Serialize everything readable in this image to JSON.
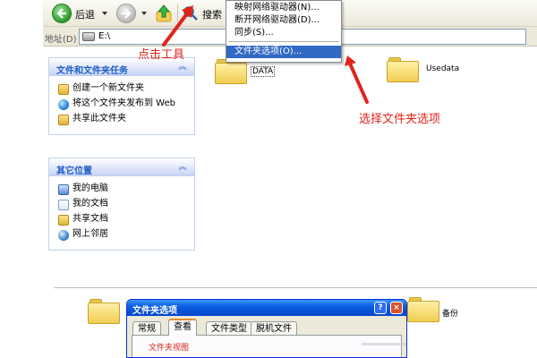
{
  "toolbar": {
    "back_label": "后退",
    "search_label": "搜索"
  },
  "address": {
    "label": "地址(D)",
    "path": "E:\\"
  },
  "file_tasks": {
    "title": "文件和文件夹任务",
    "items": [
      {
        "label": "创建一个新文件夹",
        "icon": "new-folder-icon"
      },
      {
        "label": "将这个文件夹发布到 Web",
        "icon": "globe-icon"
      },
      {
        "label": "共享此文件夹",
        "icon": "share-icon"
      }
    ]
  },
  "other_places": {
    "title": "其它位置",
    "items": [
      {
        "label": "我的电脑",
        "icon": "computer-icon"
      },
      {
        "label": "我的文档",
        "icon": "documents-icon"
      },
      {
        "label": "共享文档",
        "icon": "shared-docs-icon"
      },
      {
        "label": "网上邻居",
        "icon": "network-icon"
      }
    ]
  },
  "context_menu": {
    "items": [
      {
        "label": "映射网络驱动器(N)..."
      },
      {
        "label": "断开网络驱动器(D)..."
      },
      {
        "label": "同步(S)..."
      },
      {
        "label": "文件夹选项(O)...",
        "highlighted": true
      }
    ]
  },
  "folders": {
    "data": "DATA",
    "usedata": "Usedata",
    "backup": "备份"
  },
  "annotations": {
    "click_tools": "点击工具",
    "choose_folder_options": "选择文件夹选项"
  },
  "dialog": {
    "title": "文件夹选项",
    "tabs": [
      "常规",
      "查看",
      "文件类型",
      "脱机文件"
    ],
    "active_tab": "查看",
    "group_label": "文件夹视图",
    "help_button": "?",
    "close_button": "×"
  },
  "colors": {
    "annotation_red": "#e0231b",
    "menu_highlight": "#316ac5",
    "pane_blue": "#d6dff7"
  }
}
